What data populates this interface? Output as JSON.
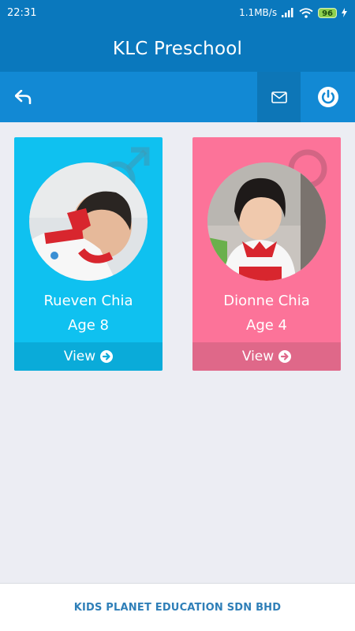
{
  "status_bar": {
    "time": "22:31",
    "network_speed": "1.1MB/s",
    "battery": "96",
    "icons": [
      "signal-icon",
      "wifi-icon",
      "battery-icon",
      "charging-icon"
    ]
  },
  "app_bar": {
    "title": "KLC Preschool"
  },
  "toolbar": {
    "back_icon": "back-arrow-icon",
    "mail_icon": "mail-icon",
    "power_icon": "power-icon"
  },
  "children": [
    {
      "name": "Rueven Chia",
      "age": "Age 8",
      "gender": "male",
      "view_label": "View",
      "card_color": "#0fc1f0"
    },
    {
      "name": "Dionne Chia",
      "age": "Age 4",
      "gender": "female",
      "view_label": "View",
      "card_color": "#fc7399"
    }
  ],
  "footer": {
    "text": "KIDS PLANET EDUCATION SDN BHD"
  },
  "colors": {
    "primary": "#0a78bd",
    "toolbar": "#1289d4",
    "boy": "#0fc1f0",
    "girl": "#fc7399",
    "background": "#ecedf3"
  }
}
